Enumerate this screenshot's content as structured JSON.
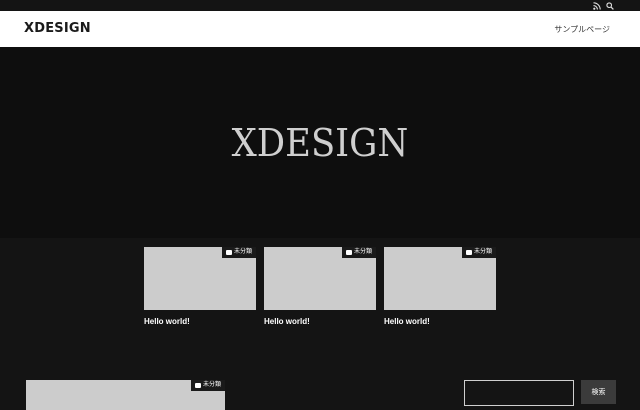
{
  "topbar": {
    "icons": [
      "rss-icon",
      "search-icon"
    ]
  },
  "header": {
    "logo": "XDESIGN",
    "nav": [
      {
        "label": "サンプルページ"
      }
    ]
  },
  "hero": {
    "title": "XDESIGN"
  },
  "posts": [
    {
      "category": "未分類",
      "title": "Hello world!"
    },
    {
      "category": "未分類",
      "title": "Hello world!"
    },
    {
      "category": "未分類",
      "title": "Hello world!"
    }
  ],
  "bottom_post": {
    "category": "未分類"
  },
  "sidebar": {
    "search_button": "検索",
    "search_value": ""
  },
  "colors": {
    "background": "#141414",
    "hero_background": "#0e0e0e",
    "header_background": "#ffffff",
    "thumbnail": "#cccccc",
    "button": "#3b3b3b"
  }
}
